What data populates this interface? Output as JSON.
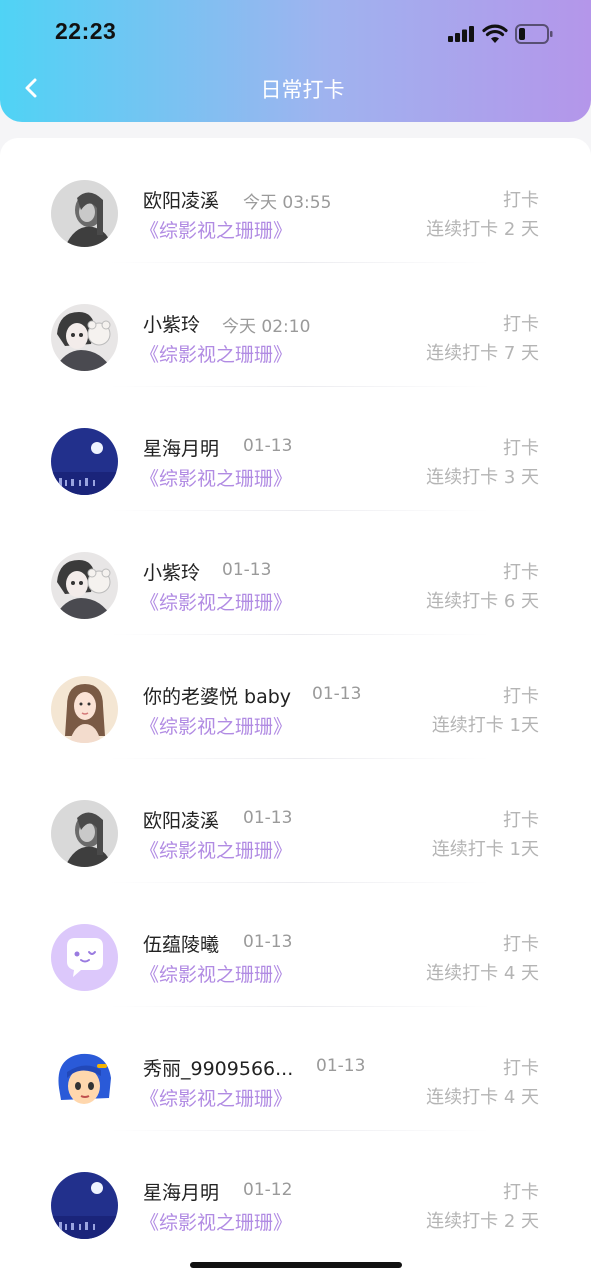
{
  "status_bar": {
    "time": "22:23"
  },
  "header": {
    "title": "日常打卡"
  },
  "colors": {
    "gradient_start": "#4fd3f5",
    "gradient_end": "#b496ea",
    "book_title": "#b18be3"
  },
  "checkins": [
    {
      "name": "欧阳凌溪",
      "date": "今天 03:55",
      "book": "《综影视之珊珊》",
      "action": "打卡",
      "streak": "连续打卡 2 天",
      "avatar": "girl-gray"
    },
    {
      "name": "小紫玲",
      "date": "今天 02:10",
      "book": "《综影视之珊珊》",
      "action": "打卡",
      "streak": "连续打卡 7 天",
      "avatar": "anime-boy"
    },
    {
      "name": "星海月明",
      "date": "01-13",
      "book": "《综影视之珊珊》",
      "action": "打卡",
      "streak": "连续打卡 3 天",
      "avatar": "night-moon"
    },
    {
      "name": "小紫玲",
      "date": "01-13",
      "book": "《综影视之珊珊》",
      "action": "打卡",
      "streak": "连续打卡 6 天",
      "avatar": "anime-boy"
    },
    {
      "name": "你的老婆悦 baby",
      "date": "01-13",
      "book": "《综影视之珊珊》",
      "action": "打卡",
      "streak": "连续打卡 1天",
      "avatar": "girl-painting"
    },
    {
      "name": "欧阳凌溪",
      "date": "01-13",
      "book": "《综影视之珊珊》",
      "action": "打卡",
      "streak": "连续打卡 1天",
      "avatar": "girl-gray"
    },
    {
      "name": "伍蕴陵曦",
      "date": "01-13",
      "book": "《综影视之珊珊》",
      "action": "打卡",
      "streak": "连续打卡 4 天",
      "avatar": "chat-bubble"
    },
    {
      "name": "秀丽_9909566...",
      "date": "01-13",
      "book": "《综影视之珊珊》",
      "action": "打卡",
      "streak": "连续打卡 4 天",
      "avatar": "cartoon-blue-hair"
    },
    {
      "name": "星海月明",
      "date": "01-12",
      "book": "《综影视之珊珊》",
      "action": "打卡",
      "streak": "连续打卡 2 天",
      "avatar": "night-moon"
    }
  ]
}
